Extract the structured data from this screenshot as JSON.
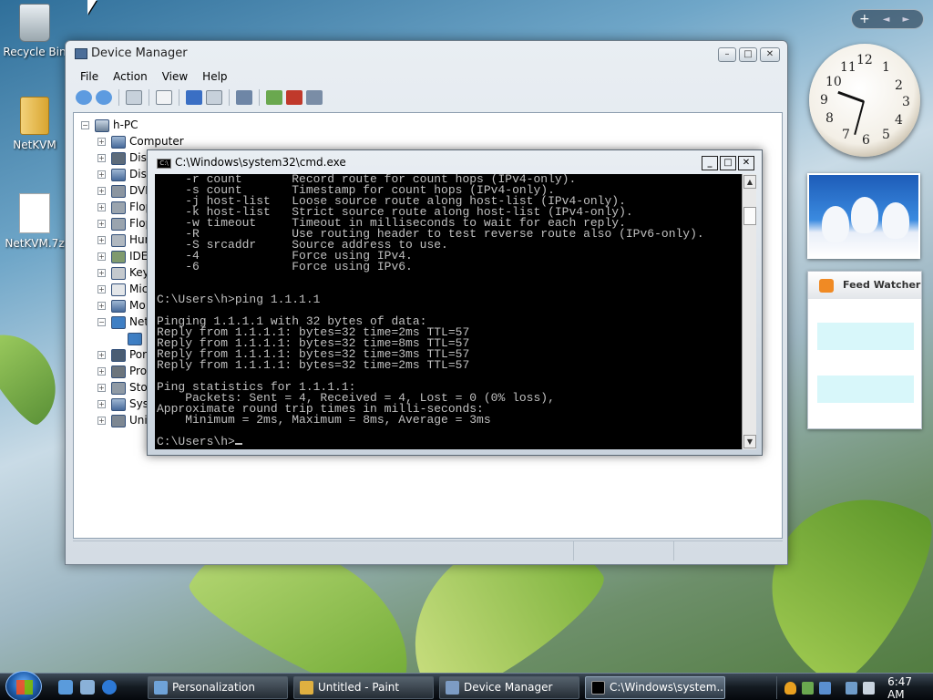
{
  "desktop": {
    "icons": [
      {
        "label": "Recycle Bin"
      },
      {
        "label": "NetKVM"
      },
      {
        "label": "NetKVM.7z"
      }
    ]
  },
  "device_manager": {
    "title": "Device Manager",
    "menu": [
      "File",
      "Action",
      "View",
      "Help"
    ],
    "tree": {
      "root": "h-PC",
      "items": [
        "Computer",
        "Disk",
        "Disp",
        "DVD",
        "Flop",
        "Flop",
        "Hum",
        "IDE",
        "Keyb",
        "Mic",
        "Mo",
        "Net",
        "",
        "Port",
        "Pro",
        "Sto",
        "Syst",
        "Uni"
      ]
    },
    "window_buttons": {
      "minimize": "–",
      "maximize": "□",
      "close": "✕"
    }
  },
  "cmd": {
    "title": "C:\\Windows\\system32\\cmd.exe",
    "lines": [
      "    -r count       Record route for count hops (IPv4-only).",
      "    -s count       Timestamp for count hops (IPv4-only).",
      "    -j host-list   Loose source route along host-list (IPv4-only).",
      "    -k host-list   Strict source route along host-list (IPv4-only).",
      "    -w timeout     Timeout in milliseconds to wait for each reply.",
      "    -R             Use routing header to test reverse route also (IPv6-only).",
      "    -S srcaddr     Source address to use.",
      "    -4             Force using IPv4.",
      "    -6             Force using IPv6.",
      "",
      "",
      "C:\\Users\\h>ping 1.1.1.1",
      "",
      "Pinging 1.1.1.1 with 32 bytes of data:",
      "Reply from 1.1.1.1: bytes=32 time=2ms TTL=57",
      "Reply from 1.1.1.1: bytes=32 time=8ms TTL=57",
      "Reply from 1.1.1.1: bytes=32 time=3ms TTL=57",
      "Reply from 1.1.1.1: bytes=32 time=2ms TTL=57",
      "",
      "Ping statistics for 1.1.1.1:",
      "    Packets: Sent = 4, Received = 4, Lost = 0 (0% loss),",
      "Approximate round trip times in milli-seconds:",
      "    Minimum = 2ms, Maximum = 8ms, Average = 3ms",
      "",
      "C:\\Users\\h>"
    ]
  },
  "sidebar": {
    "add_label": "+",
    "feed_title": "Feed Watcher",
    "clock_numbers": [
      "12",
      "1",
      "2",
      "3",
      "4",
      "5",
      "6",
      "7",
      "8",
      "9",
      "10",
      "11"
    ]
  },
  "taskbar": {
    "tasks": [
      {
        "label": "Personalization"
      },
      {
        "label": "Untitled - Paint"
      },
      {
        "label": "Device Manager"
      },
      {
        "label": "C:\\Windows\\system..."
      }
    ],
    "time": "6:47 AM"
  }
}
